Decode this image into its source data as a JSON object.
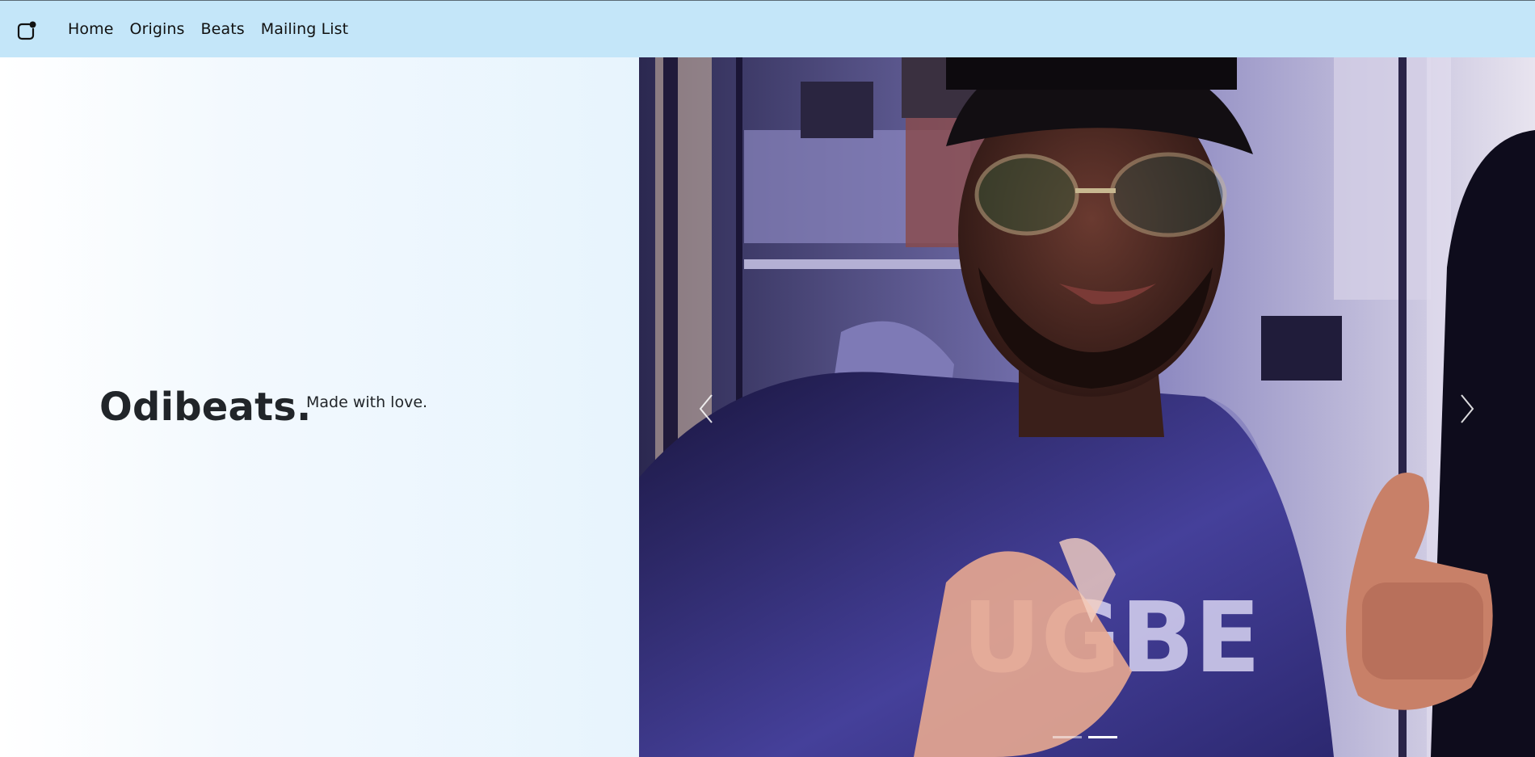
{
  "navbar": {
    "logo_icon": "app-logo-icon",
    "links": [
      {
        "label": "Home"
      },
      {
        "label": "Origins"
      },
      {
        "label": "Beats"
      },
      {
        "label": "Mailing List"
      }
    ],
    "background_color": "#c4e6f9"
  },
  "hero": {
    "title": "Odibeats.",
    "subtitle": "Made with love."
  },
  "carousel": {
    "prev_icon": "chevron-left-icon",
    "next_icon": "chevron-right-icon",
    "slide_count": 2,
    "active_slide": 2
  }
}
